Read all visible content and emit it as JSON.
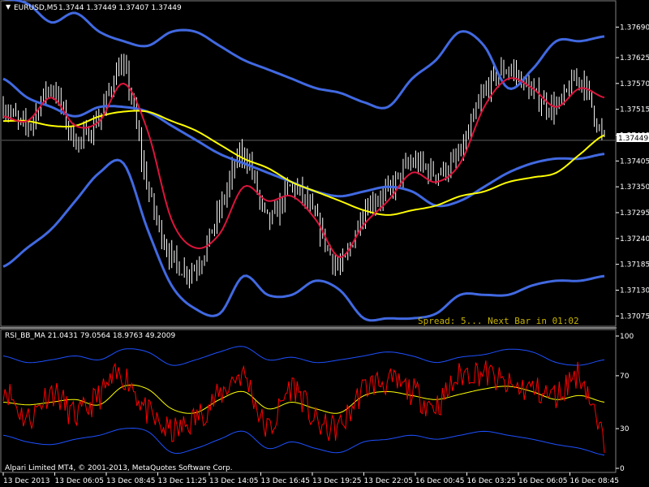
{
  "header": {
    "title": "EURUSD,M5",
    "ohlc": "1.3744 1.37449 1.37407 1.37449"
  },
  "indicator_header": "RSI_BB_MA 21.0431 79.0564 18.9763 49.2009",
  "spread_text": "Spread: 5... Next Bar in 01:02",
  "copyright": "Alpari Limited MT4, © 2001-2013, MetaQuotes Software Corp.",
  "current_price": "1.37449",
  "colors": {
    "background": "#000000",
    "candles": "#ffffff",
    "bollinger": "#4169e1",
    "ma_slow": "#ffff00",
    "ma_fast": "#dc143c",
    "rsi": "#ff0000",
    "rsi_bands": "#1e50ff",
    "rsi_ma": "#ffff00",
    "spread_text": "#c8b400",
    "grid": "#404040"
  },
  "chart_data": [
    {
      "type": "line",
      "series_desc": "EURUSD M5 price chart with Bollinger Bands and moving averages",
      "price_ticks": [
        "1.37690",
        "1.37625",
        "1.37570",
        "1.37515",
        "1.37460",
        "1.37405",
        "1.37350",
        "1.37295",
        "1.37240",
        "1.37185",
        "1.37130",
        "1.37075"
      ],
      "price_tick_values": [
        1.3769,
        1.37625,
        1.3757,
        1.37515,
        1.3746,
        1.37405,
        1.3735,
        1.37295,
        1.3724,
        1.37185,
        1.3713,
        1.37075
      ],
      "ylim": [
        1.3706,
        1.3772
      ],
      "xlim": [
        0,
        100
      ],
      "x": [
        0,
        4,
        8,
        12,
        16,
        20,
        24,
        28,
        32,
        36,
        40,
        44,
        48,
        52,
        56,
        60,
        64,
        68,
        72,
        76,
        80,
        84,
        88,
        92,
        96,
        100
      ],
      "close": [
        1.3752,
        1.3748,
        1.3756,
        1.3745,
        1.375,
        1.376,
        1.3735,
        1.372,
        1.3718,
        1.373,
        1.3742,
        1.3728,
        1.3735,
        1.3728,
        1.3718,
        1.373,
        1.3734,
        1.374,
        1.3738,
        1.3742,
        1.3755,
        1.376,
        1.3755,
        1.3752,
        1.3758,
        1.3745
      ],
      "high": [
        1.3755,
        1.3752,
        1.3759,
        1.3749,
        1.3754,
        1.3768,
        1.3748,
        1.3728,
        1.3726,
        1.3736,
        1.3752,
        1.3735,
        1.374,
        1.3733,
        1.3723,
        1.3734,
        1.3744,
        1.3745,
        1.3742,
        1.3746,
        1.376,
        1.3763,
        1.3759,
        1.3756,
        1.3762,
        1.3761
      ],
      "low": [
        1.3747,
        1.3743,
        1.3751,
        1.3741,
        1.3746,
        1.3752,
        1.3718,
        1.371,
        1.3713,
        1.372,
        1.3733,
        1.3718,
        1.3728,
        1.372,
        1.3712,
        1.3725,
        1.3728,
        1.3735,
        1.3734,
        1.3737,
        1.3746,
        1.3754,
        1.375,
        1.3747,
        1.375,
        1.3736
      ],
      "bb_upper": [
        1.3775,
        1.3774,
        1.377,
        1.3772,
        1.3768,
        1.3766,
        1.3765,
        1.3768,
        1.3768,
        1.3765,
        1.3762,
        1.376,
        1.3758,
        1.3756,
        1.3755,
        1.3753,
        1.3752,
        1.3758,
        1.3762,
        1.3768,
        1.3765,
        1.3756,
        1.376,
        1.3766,
        1.3766,
        1.3767
      ],
      "bb_mid": [
        1.3758,
        1.3754,
        1.3752,
        1.375,
        1.3752,
        1.3752,
        1.3751,
        1.3748,
        1.3745,
        1.3742,
        1.374,
        1.3738,
        1.3736,
        1.3734,
        1.3733,
        1.3734,
        1.3735,
        1.3734,
        1.3731,
        1.3732,
        1.3735,
        1.3738,
        1.374,
        1.3741,
        1.3741,
        1.3742
      ],
      "bb_lower": [
        1.3718,
        1.3722,
        1.3726,
        1.3732,
        1.3738,
        1.374,
        1.3726,
        1.3714,
        1.3709,
        1.3708,
        1.3716,
        1.3712,
        1.3712,
        1.3715,
        1.3713,
        1.3707,
        1.3707,
        1.3707,
        1.3708,
        1.3712,
        1.3712,
        1.3712,
        1.3714,
        1.3715,
        1.3715,
        1.3716
      ],
      "ma_slow": [
        1.3749,
        1.3749,
        1.3748,
        1.3748,
        1.375,
        1.3751,
        1.3751,
        1.3749,
        1.3747,
        1.3744,
        1.3741,
        1.3739,
        1.3736,
        1.3734,
        1.3732,
        1.373,
        1.3729,
        1.373,
        1.3731,
        1.3733,
        1.3734,
        1.3736,
        1.3737,
        1.3738,
        1.3742,
        1.3746
      ],
      "ma_fast": [
        1.375,
        1.3749,
        1.3754,
        1.3748,
        1.3749,
        1.3757,
        1.3747,
        1.3728,
        1.3722,
        1.3725,
        1.3735,
        1.3732,
        1.3733,
        1.3728,
        1.372,
        1.3727,
        1.3732,
        1.3738,
        1.3736,
        1.374,
        1.3752,
        1.3758,
        1.3756,
        1.3752,
        1.3756,
        1.3754
      ]
    },
    {
      "type": "line",
      "series_desc": "RSI with Bollinger Bands and moving average",
      "rsi_ticks": [
        "100",
        "70",
        "30",
        "0"
      ],
      "rsi_tick_values": [
        100,
        70,
        30,
        0
      ],
      "ylim": [
        0,
        100
      ],
      "xlim": [
        0,
        100
      ],
      "x": [
        0,
        4,
        8,
        12,
        16,
        20,
        24,
        28,
        32,
        36,
        40,
        44,
        48,
        52,
        56,
        60,
        64,
        68,
        72,
        76,
        80,
        84,
        88,
        92,
        96,
        100
      ],
      "rsi": [
        62,
        38,
        58,
        40,
        55,
        70,
        42,
        28,
        38,
        55,
        70,
        30,
        62,
        35,
        32,
        60,
        65,
        58,
        48,
        70,
        72,
        62,
        60,
        55,
        70,
        20
      ],
      "rsi_upper": [
        85,
        80,
        82,
        85,
        82,
        90,
        88,
        78,
        82,
        88,
        92,
        82,
        84,
        80,
        82,
        85,
        88,
        85,
        80,
        84,
        86,
        90,
        88,
        80,
        78,
        82
      ],
      "rsi_mid": [
        50,
        48,
        50,
        52,
        48,
        62,
        60,
        45,
        42,
        52,
        58,
        45,
        50,
        45,
        42,
        55,
        58,
        55,
        52,
        56,
        60,
        62,
        58,
        52,
        55,
        50
      ],
      "rsi_lower": [
        25,
        20,
        18,
        22,
        25,
        30,
        28,
        12,
        15,
        22,
        28,
        15,
        20,
        15,
        12,
        20,
        22,
        25,
        22,
        25,
        28,
        25,
        22,
        18,
        15,
        10
      ],
      "time_labels": [
        "13 Dec 2013",
        "13 Dec 06:05",
        "13 Dec 08:45",
        "13 Dec 11:25",
        "13 Dec 14:05",
        "13 Dec 16:45",
        "13 Dec 19:25",
        "13 Dec 22:05",
        "16 Dec 00:45",
        "16 Dec 03:25",
        "16 Dec 06:05",
        "16 Dec 08:45"
      ]
    }
  ]
}
